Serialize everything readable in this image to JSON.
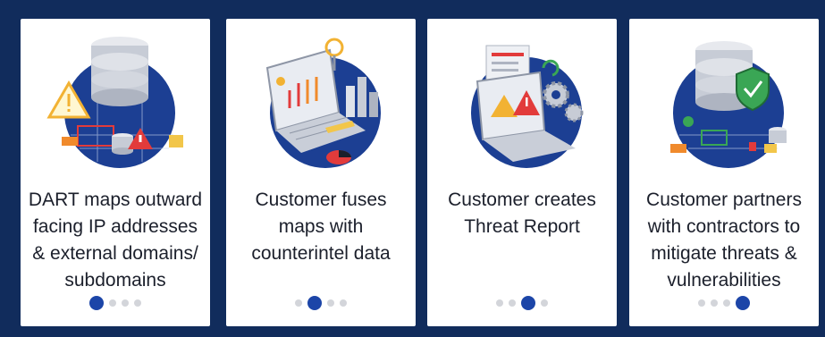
{
  "colors": {
    "background": "#112c5c",
    "card": "#ffffff",
    "accent": "#1c45a8",
    "dot_inactive": "#d3d5da",
    "text": "#1b1f2b"
  },
  "cards": [
    {
      "icon": "database-warning-illustration",
      "caption": "DART maps outward facing IP addresses & external domains/ subdomains",
      "dots": {
        "total": 4,
        "active": 1
      }
    },
    {
      "icon": "laptop-analytics-illustration",
      "caption": "Customer fuses maps with counterintel data",
      "dots": {
        "total": 4,
        "active": 2
      }
    },
    {
      "icon": "threat-report-laptop-illustration",
      "caption": "Customer creates Threat Report",
      "dots": {
        "total": 4,
        "active": 3
      }
    },
    {
      "icon": "database-shield-illustration",
      "caption": "Customer partners with contractors to mitigate threats & vulnerabilities",
      "dots": {
        "total": 4,
        "active": 4
      }
    }
  ]
}
